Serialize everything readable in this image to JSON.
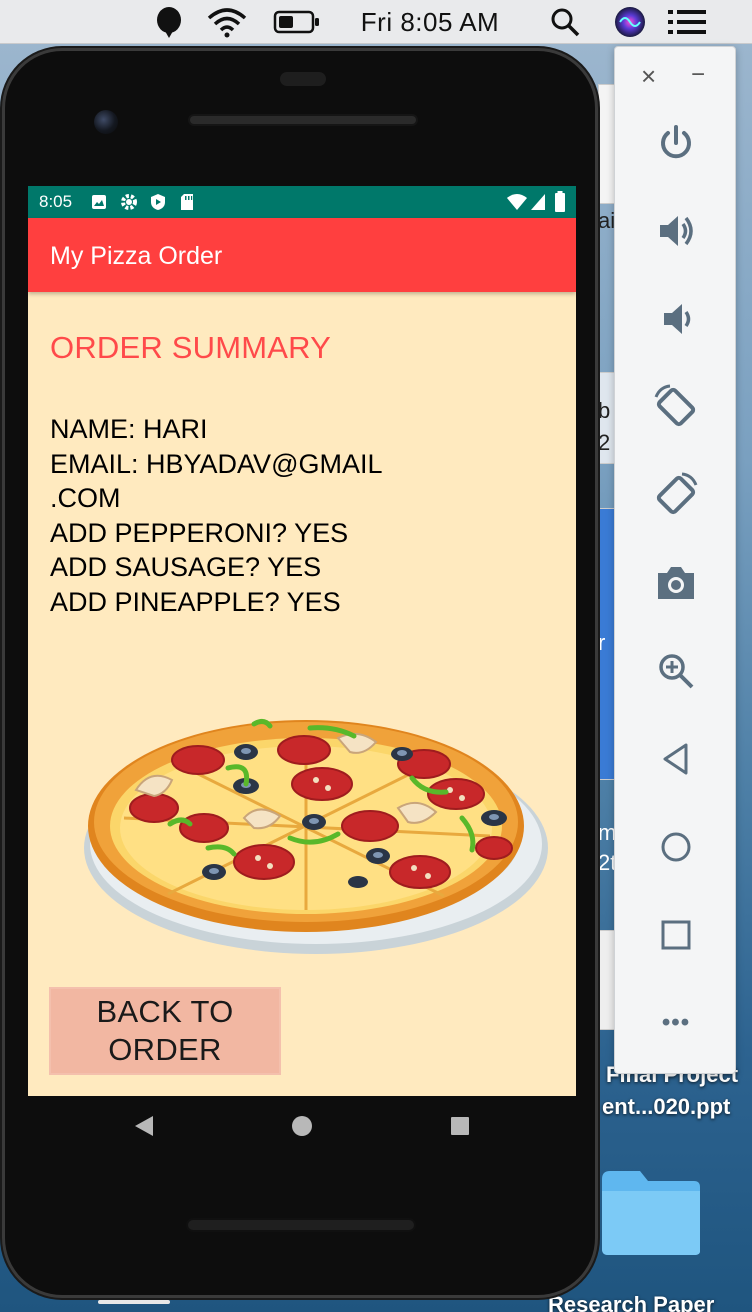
{
  "menubar": {
    "clock": "Fri 8:05 AM",
    "icons": [
      "grammarly-icon",
      "wifi-icon",
      "battery-icon",
      "search-icon",
      "siri-icon",
      "control-center-icon"
    ]
  },
  "desktop": {
    "fragments": [
      "ai",
      "b",
      "2",
      "r",
      "m",
      "2t"
    ],
    "file_label_line1": "Final Project",
    "file_label_line2": "ent...020.ppt",
    "folder_label": "Research Paper"
  },
  "emulator_toolbar": {
    "close": "×",
    "minimize": "−",
    "buttons": [
      "power-icon",
      "volume-up-icon",
      "volume-down-icon",
      "rotate-left-icon",
      "rotate-right-icon",
      "camera-icon",
      "zoom-icon",
      "back-icon",
      "home-icon",
      "overview-icon",
      "more-icon"
    ],
    "more_label": "•••"
  },
  "android": {
    "status_time": "8:05",
    "app_title": "My Pizza Order",
    "summary_heading": "ORDER SUMMARY",
    "summary": {
      "name_line": "NAME: HARI",
      "email_line1": "EMAIL: HBYADAV@GMAIL",
      "email_line2": ".COM",
      "pepperoni_line": "ADD PEPPERONI? YES",
      "sausage_line": "ADD SAUSAGE? YES",
      "pineapple_line": "ADD PINEAPPLE? YES"
    },
    "back_button_line1": "BACK TO",
    "back_button_line2": "ORDER"
  },
  "colors": {
    "status_bar": "#00786a",
    "app_bar": "#ff3f3f",
    "screen_bg": "#ffeabf",
    "heading": "#ff4a4a",
    "button_bg": "#f2b7a2"
  }
}
